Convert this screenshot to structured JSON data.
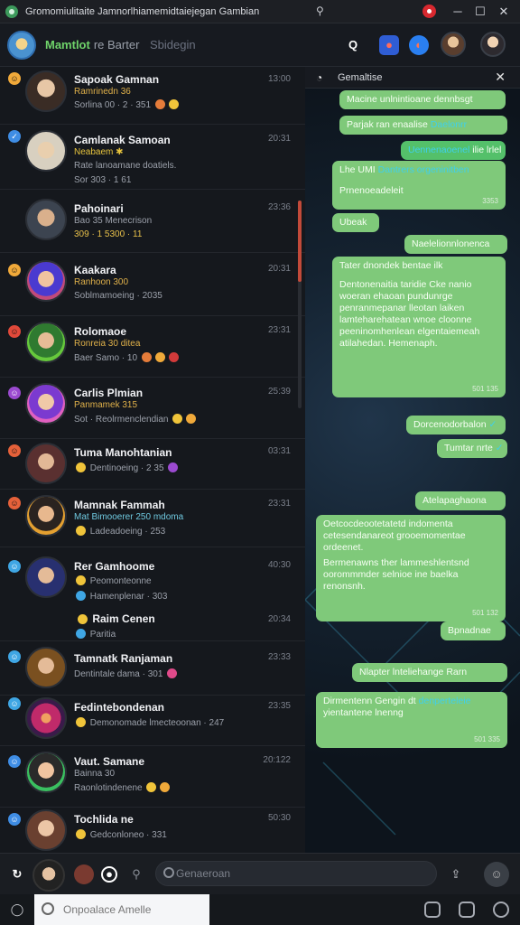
{
  "window": {
    "title": "Gromomiulitaite Jamnorlhiamemidtaiejegan Gambian",
    "pin_icon": "pin-icon",
    "controls": [
      "minimize",
      "maximize",
      "close"
    ]
  },
  "header": {
    "name": "Mamtlot",
    "name_suffix": "re Barter",
    "subtitle": "Sbidegin"
  },
  "chats": [
    {
      "name": "Sapoak Gamnan",
      "time": "13:00",
      "line2": "Ramrinedn 36",
      "line3": "Sorlina 00 · 2 · 351"
    },
    {
      "name": "Camlanak Samoan",
      "time": "20:31",
      "line2": "Neabaem ✱",
      "line3": "Rate lanoamane doatiels.",
      "sub": "Sor 303 · 1 61"
    },
    {
      "name": "Pahoinari",
      "time": "23:36",
      "line2": "Bao 35 Menecrison",
      "line3": "309 · 1 5300 · 11"
    },
    {
      "name": "Kaakara",
      "time": "20:31",
      "line2": "Ranhoon 300",
      "line3": "Soblmamoeing · 2035"
    },
    {
      "name": "Rolomaoe",
      "time": "23:31",
      "line2": "Ronreia 30 ditea",
      "line3": "Baer Samo · 10"
    },
    {
      "name": "Carlis Plmian",
      "time": "25:39",
      "line2": "Panmamek 315",
      "line3": "Sot · Reolrmenclendian"
    },
    {
      "name": "Tuma Manohtanian",
      "time": "03:31",
      "line2": "",
      "line3": "Dentinoeing · 2 35"
    },
    {
      "name": "Mamnak Fammah",
      "time": "23:31",
      "line2": "Mat Bimooerer 250 mdoma",
      "line3": "Ladeadoeing · 253"
    },
    {
      "name": "Rer Gamhoome",
      "time": "40:30",
      "line2": "Peomonteonne",
      "line3": "Hamenplenar · 303",
      "extra_name": "Raim Cenen",
      "extra_time": "20:34",
      "extra_sub": "Paritia"
    },
    {
      "name": "Tamnatk Ranjaman",
      "time": "23:33",
      "line2": "",
      "line3": "Dentintale dama · 301"
    },
    {
      "name": "Fedintebondenan",
      "time": "23:35",
      "line2": "",
      "line3": "Demonomade lmecteoonan · 247"
    },
    {
      "name": "Vaut. Samane",
      "time": "20:122",
      "line2": "Bainna 30",
      "line3": "Raonlotindenene"
    },
    {
      "name": "Tochlida ne",
      "time": "50:30",
      "line2": "",
      "line3": "Gedconloneo · 331"
    }
  ],
  "panel": {
    "title": "Gemaltise",
    "messages": [
      {
        "text": "Macine unlnintioane dennbsgt",
        "time": ""
      },
      {
        "text": "Parjak ran enaalise",
        "highlight": "Daelonrr",
        "time": ""
      },
      {
        "text": "Uennenaoenel",
        "highlight2": "ilie lrlel",
        "time": ""
      },
      {
        "text": "Lhe UMI",
        "highlight": "Dantrers orgeninitben",
        "second": "Prnenoeadeleit",
        "time": "3353"
      },
      {
        "text": "Ubeak",
        "time": ""
      },
      {
        "text": "Naelelionnlonenca",
        "time": ""
      },
      {
        "text": "Tater dnondek bentae ilk",
        "body": "Dentonenaitia taridie Cke nanio woeran ehaoan pundunrge penranmepanar lleotan laiken lamteharehatean wnoe cloonne peeninomhenlean elgentaiemeah atilahedan. Hemenaph.",
        "time": "501 135"
      },
      {
        "text": "Dorcenodorbalon",
        "time": ""
      },
      {
        "text": "Tumtar nrte",
        "time": ""
      },
      {
        "text": "Atelapaghaona",
        "time": ""
      },
      {
        "text": "Oetcocdeootetatetd indomenta cetesendanareot grooemomentae ordeenet.",
        "body": "Bermenawns ther lammeshlentsnd oorommmder selnioe ine baelka renonsnh.",
        "time": "501 132"
      },
      {
        "text": "Bpnadnae",
        "time": ""
      },
      {
        "text": "Nlapter lnteliehange Rarn",
        "time": ""
      },
      {
        "text": "Dirmentenn Gengin dt",
        "highlight": "denperteleie",
        "body": "yientantene lnenng",
        "time": "501 335"
      }
    ]
  },
  "bottombar": {
    "search_placeholder": "Genaeroan"
  },
  "footer": {
    "input_placeholder": "Onpoalace Amelle"
  }
}
